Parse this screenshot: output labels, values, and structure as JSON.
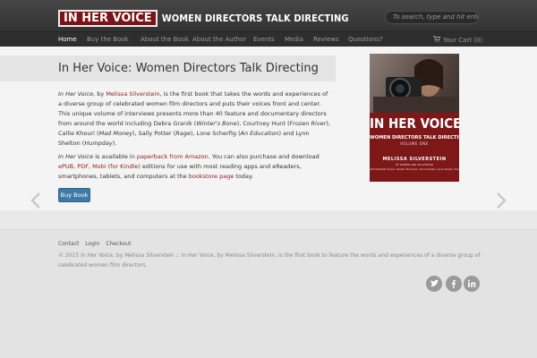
{
  "header": {
    "logo_main": "IN HER VOICE",
    "logo_sub": "WOMEN DIRECTORS TALK DIRECTING",
    "search_placeholder": "To search, type and hit ente"
  },
  "nav": {
    "items": [
      {
        "label": "Home",
        "active": true
      },
      {
        "label": "Buy the Book"
      },
      {
        "label": "About the Book"
      },
      {
        "label": "About the Author"
      },
      {
        "label": "Events"
      },
      {
        "label": "Media"
      },
      {
        "label": "Reviews"
      },
      {
        "label": "Questions?"
      }
    ],
    "cart_label": "Your Cart (0)"
  },
  "main": {
    "title": "In Her Voice: Women Directors Talk Directing",
    "p1": {
      "s1": "In Her Voice",
      "s2": ", by ",
      "s3": "Melissa Silverstein",
      "s4": ", is the first book that takes the words and experiences of a diverse group of celebrated women film directors and puts their voices front and center. This unique volume of interviews presents more than 40 feature and documentary directors from around the world including Debra Granik (",
      "s5": "Winter's Bone",
      "s6": "), Courtney Hunt (",
      "s7": "Frozen River",
      "s8": "), Callie Khouri (",
      "s9": "Mad Money",
      "s10": "), Sally Potter (",
      "s11": "Rage",
      "s12": "), Lone Scherfig (",
      "s13": "An Education",
      "s14": ") and Lynn Shelton (",
      "s15": "Humpday",
      "s16": ")."
    },
    "p2": {
      "s1": "In Her Voice",
      "s2": " is available in ",
      "s3": "paperback from Amazon",
      "s4": ". You can also purchase and download ",
      "s5": "ePUB, PDF, Mobi (for Kindle)",
      "s6": " editions for use with most reading apps and eReaders, smartphones, tablets, and computers at the ",
      "s7": "bookstore page",
      "s8": " today."
    },
    "buy_button": "Buy Book"
  },
  "book": {
    "title": "IN HER VOICE",
    "subtitle": "WOMEN DIRECTORS TALK DIRECTING",
    "volume": "VOLUME ONE",
    "author": "MELISSA SILVERSTEIN",
    "by_line": "OF WOMEN AND HOLLYWOOD",
    "contributors": "with Elizabeth Harper, Heather McLendon, Eva Krainitzki, Laura Shields, Emilie Stengel"
  },
  "footer": {
    "links": [
      "Contact",
      "Login",
      "Checkout"
    ],
    "copyright": "© 2015 In Her Voice, by Melissa Silverstein  ::  In Her Voice, by Melissa Silverstein, is the first book to feature the words and experiences of a diverse group of celebrated women film directors.",
    "social": [
      "twitter-icon",
      "facebook-icon",
      "linkedin-icon"
    ]
  },
  "colors": {
    "accent": "#7a1416",
    "link": "#8c1d1d",
    "button": "#3f79a6"
  }
}
